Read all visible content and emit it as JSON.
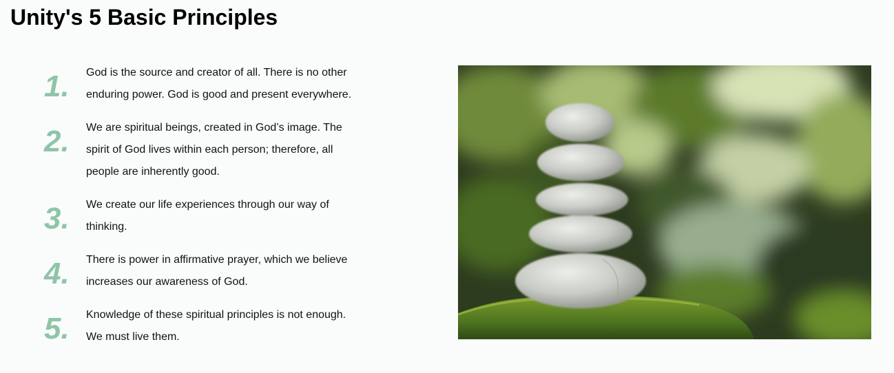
{
  "page": {
    "title": "Unity's 5 Basic Principles"
  },
  "principles": [
    {
      "number": "1.",
      "text": "God is the source and creator of all. There is no other enduring power. God is good and present everywhere."
    },
    {
      "number": "2.",
      "text": "We are spiritual beings, created in God’s image. The spirit of God lives within each person; therefore, all people are inherently good."
    },
    {
      "number": "3.",
      "text": "We create our life experiences through our way of thinking."
    },
    {
      "number": "4.",
      "text": "There is power in affirmative prayer, which we believe increases our awareness of God."
    },
    {
      "number": "5.",
      "text": "Knowledge of these spiritual principles is not enough. We must live them."
    }
  ],
  "colors": {
    "number_accent": "#8ec5a8",
    "background": "#fafcfb"
  },
  "image": {
    "subject": "stacked-stones-on-moss-photo"
  }
}
